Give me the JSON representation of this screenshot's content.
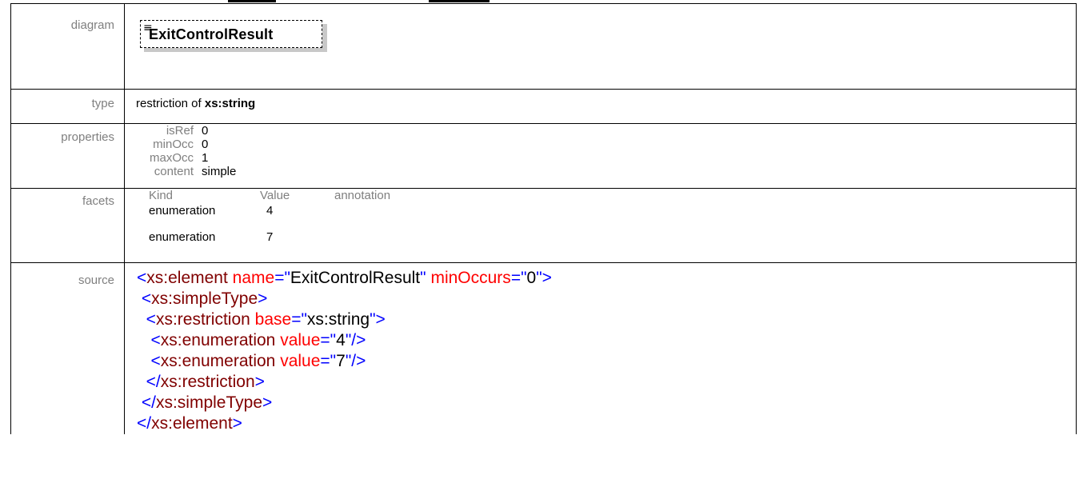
{
  "diagram": {
    "label": "diagram",
    "element_name": "ExitControlResult",
    "icon": "list-lines-icon"
  },
  "type_row": {
    "label": "type",
    "prefix": "restriction of ",
    "base": "xs:string"
  },
  "properties": {
    "label": "properties",
    "items": [
      {
        "key": "isRef",
        "value": "0"
      },
      {
        "key": "minOcc",
        "value": "0"
      },
      {
        "key": "maxOcc",
        "value": "1"
      },
      {
        "key": "content",
        "value": "simple"
      }
    ]
  },
  "facets": {
    "label": "facets",
    "headers": {
      "kind": "Kind",
      "value": "Value",
      "annotation": "annotation"
    },
    "rows": [
      {
        "kind": "enumeration",
        "value": "4"
      },
      {
        "kind": "enumeration",
        "value": "7"
      }
    ]
  },
  "source": {
    "label": "source",
    "lines": [
      {
        "indent": "",
        "parts": [
          [
            "b",
            "<"
          ],
          [
            "n",
            "xs:element"
          ],
          [
            "v",
            " "
          ],
          [
            "a",
            "name"
          ],
          [
            "b",
            "=\""
          ],
          [
            "v",
            "ExitControlResult"
          ],
          [
            "b",
            "\""
          ],
          [
            "v",
            " "
          ],
          [
            "a",
            "minOccurs"
          ],
          [
            "b",
            "=\""
          ],
          [
            "v",
            "0"
          ],
          [
            "b",
            "\">"
          ]
        ]
      },
      {
        "indent": " ",
        "parts": [
          [
            "b",
            "<"
          ],
          [
            "n",
            "xs:simpleType"
          ],
          [
            "b",
            ">"
          ]
        ]
      },
      {
        "indent": "  ",
        "parts": [
          [
            "b",
            "<"
          ],
          [
            "n",
            "xs:restriction"
          ],
          [
            "v",
            " "
          ],
          [
            "a",
            "base"
          ],
          [
            "b",
            "=\""
          ],
          [
            "v",
            "xs:string"
          ],
          [
            "b",
            "\">"
          ]
        ]
      },
      {
        "indent": "   ",
        "parts": [
          [
            "b",
            "<"
          ],
          [
            "n",
            "xs:enumeration"
          ],
          [
            "v",
            " "
          ],
          [
            "a",
            "value"
          ],
          [
            "b",
            "=\""
          ],
          [
            "v",
            "4"
          ],
          [
            "b",
            "\"/>"
          ]
        ]
      },
      {
        "indent": "   ",
        "parts": [
          [
            "b",
            "<"
          ],
          [
            "n",
            "xs:enumeration"
          ],
          [
            "v",
            " "
          ],
          [
            "a",
            "value"
          ],
          [
            "b",
            "=\""
          ],
          [
            "v",
            "7"
          ],
          [
            "b",
            "\"/>"
          ]
        ]
      },
      {
        "indent": "  ",
        "parts": [
          [
            "b",
            "</"
          ],
          [
            "n",
            "xs:restriction"
          ],
          [
            "b",
            ">"
          ]
        ]
      },
      {
        "indent": " ",
        "parts": [
          [
            "b",
            "</"
          ],
          [
            "n",
            "xs:simpleType"
          ],
          [
            "b",
            ">"
          ]
        ]
      },
      {
        "indent": "",
        "parts": [
          [
            "b",
            "</"
          ],
          [
            "n",
            "xs:element"
          ],
          [
            "b",
            ">"
          ]
        ]
      }
    ]
  }
}
